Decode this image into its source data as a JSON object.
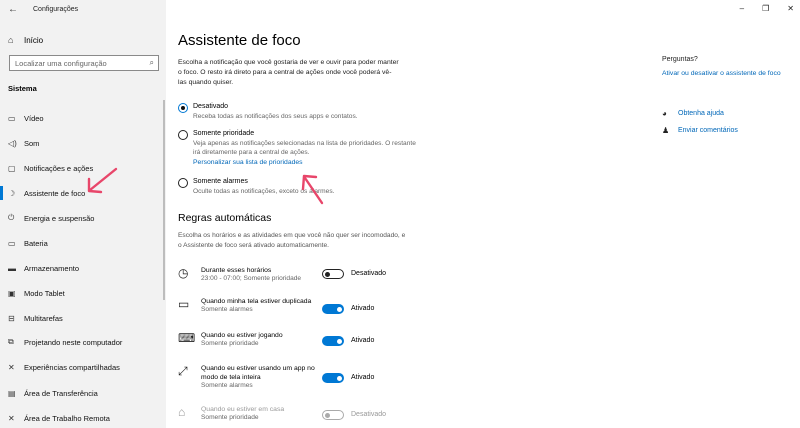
{
  "window": {
    "title": "Configurações",
    "controls": {
      "minimize": "–",
      "maximize": "❐",
      "close": "✕"
    }
  },
  "sidebar": {
    "home_label": "Início",
    "search_placeholder": "Localizar uma configuração",
    "section_label": "Sistema",
    "items": [
      {
        "label": "Vídeo",
        "icon": "monitor-icon"
      },
      {
        "label": "Som",
        "icon": "speaker-icon"
      },
      {
        "label": "Notificações e ações",
        "icon": "notification-icon"
      },
      {
        "label": "Assistente de foco",
        "icon": "moon-icon",
        "active": true
      },
      {
        "label": "Energia e suspensão",
        "icon": "power-icon"
      },
      {
        "label": "Bateria",
        "icon": "battery-icon"
      },
      {
        "label": "Armazenamento",
        "icon": "storage-icon"
      },
      {
        "label": "Modo Tablet",
        "icon": "tablet-icon"
      },
      {
        "label": "Multitarefas",
        "icon": "multitask-icon"
      },
      {
        "label": "Projetando neste computador",
        "icon": "project-icon"
      },
      {
        "label": "Experiências compartilhadas",
        "icon": "share-icon"
      },
      {
        "label": "Área de Transferência",
        "icon": "clipboard-icon"
      },
      {
        "label": "Área de Trabalho Remota",
        "icon": "remote-icon"
      }
    ]
  },
  "main": {
    "title": "Assistente de foco",
    "description": "Escolha a notificação que você gostaria de ver e ouvir para poder manter o foco. O resto irá direto para a central de ações onde você poderá vê-las quando quiser.",
    "options": [
      {
        "label": "Desativado",
        "sub": "Receba todas as notificações dos seus apps e contatos.",
        "selected": true
      },
      {
        "label": "Somente prioridade",
        "sub": "Veja apenas as notificações selecionadas na lista de prioridades. O restante irá diretamente para a central de ações.",
        "link": "Personalizar sua lista de prioridades",
        "selected": false
      },
      {
        "label": "Somente alarmes",
        "sub": "Oculte todas as notificações, exceto os alarmes.",
        "selected": false
      }
    ],
    "rules_heading": "Regras automáticas",
    "rules_description": "Escolha os horários e as atividades em que você não quer ser incomodado, e o Assistente de foco será ativado automaticamente.",
    "rules": [
      {
        "label": "Durante esses horários",
        "sub": "23:00 - 07:00; Somente prioridade",
        "state": "Desativado",
        "on": false,
        "icon": "clock-icon"
      },
      {
        "label": "Quando minha tela estiver duplicada",
        "sub": "Somente alarmes",
        "state": "Ativado",
        "on": true,
        "icon": "display-icon"
      },
      {
        "label": "Quando eu estiver jogando",
        "sub": "Somente prioridade",
        "state": "Ativado",
        "on": true,
        "icon": "gamepad-icon"
      },
      {
        "label": "Quando eu estiver usando um app no modo de tela inteira",
        "sub": "Somente alarmes",
        "state": "Ativado",
        "on": true,
        "icon": "fullscreen-icon"
      },
      {
        "label": "Quando eu estiver em casa",
        "sub": "Somente prioridade",
        "state": "Desativado",
        "on": false,
        "disabled": true,
        "icon": "house-icon"
      }
    ]
  },
  "right": {
    "questions_label": "Perguntas?",
    "questions_link": "Ativar ou desativar o assistente de foco",
    "help_label": "Obtenha ajuda",
    "feedback_label": "Enviar comentários"
  },
  "colors": {
    "accent": "#0078d4",
    "link": "#0067b8",
    "annotation": "#e8466a"
  }
}
